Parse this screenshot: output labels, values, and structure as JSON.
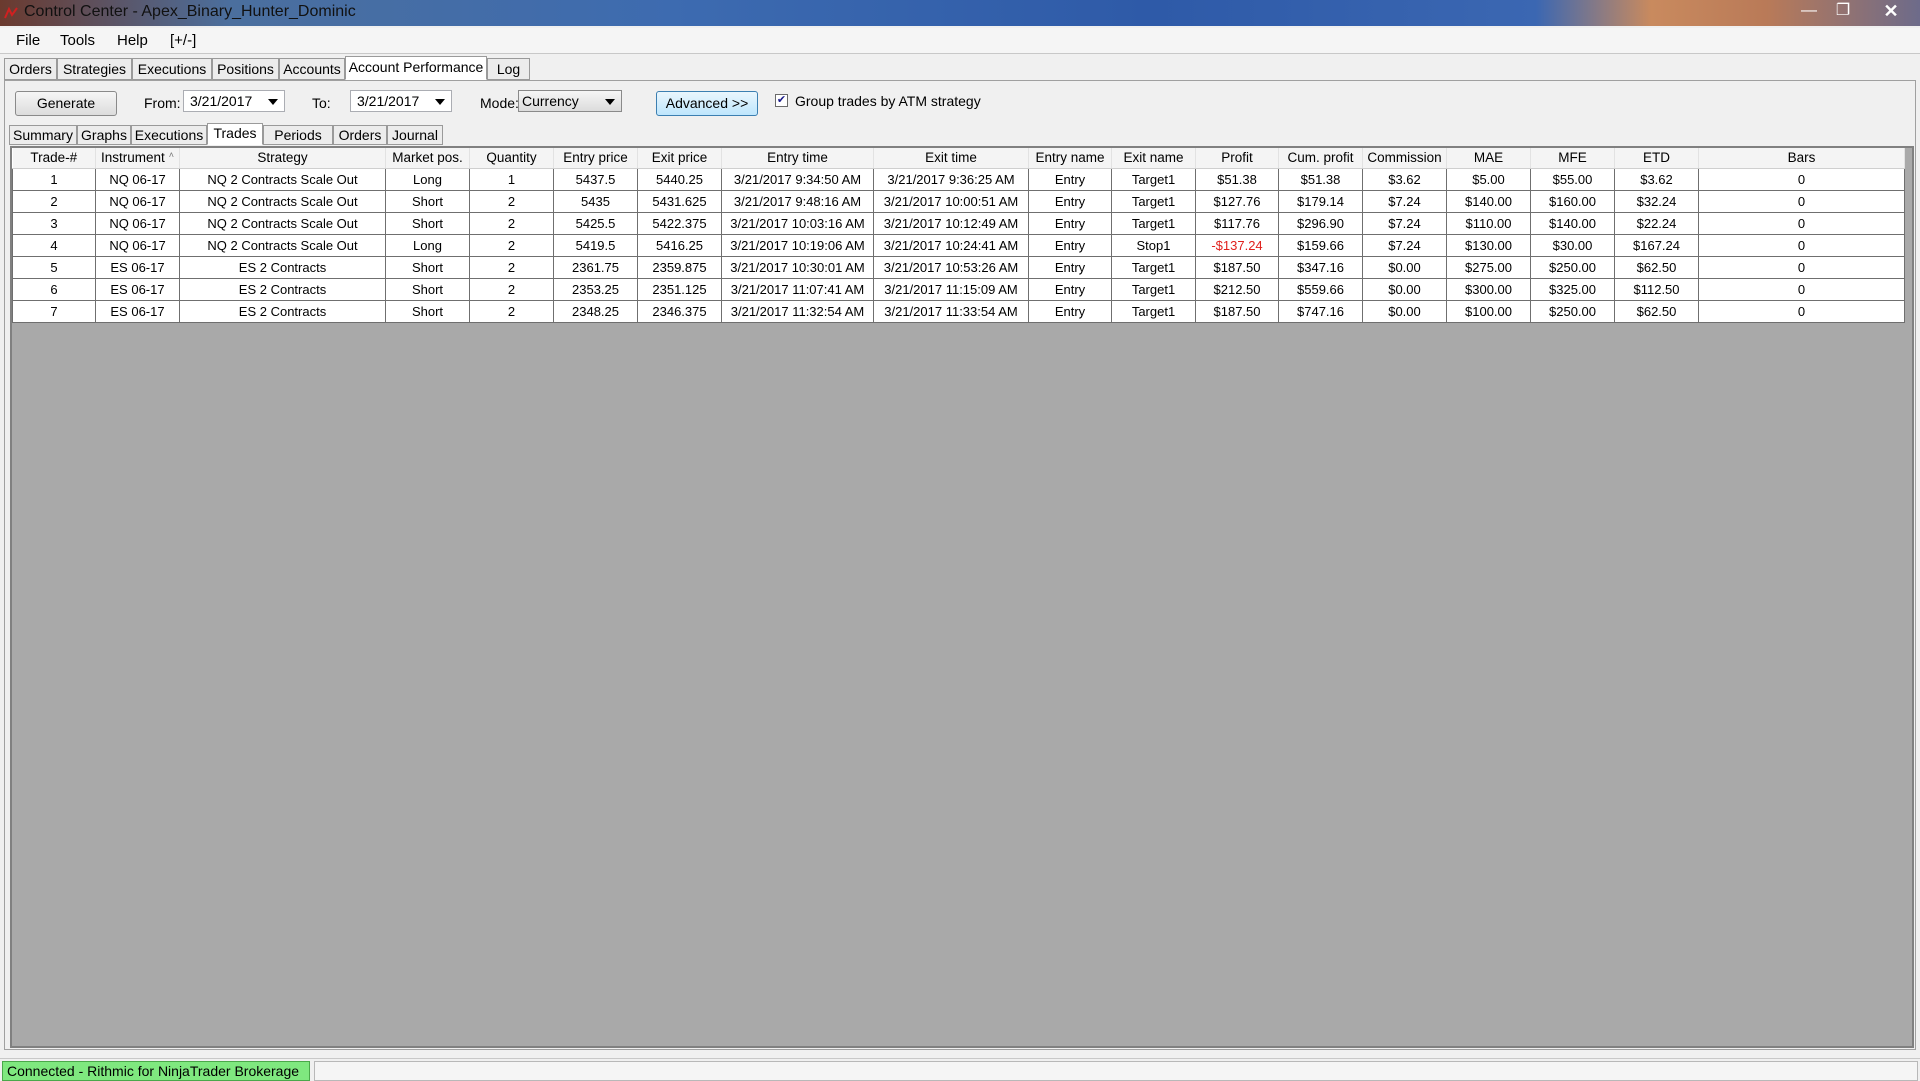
{
  "window": {
    "title": "Control Center - Apex_Binary_Hunter_Dominic",
    "minimize_glyph": "—",
    "maximize_glyph": "❐",
    "close_glyph": "✕"
  },
  "menu": {
    "file": "File",
    "tools": "Tools",
    "help": "Help",
    "toggle": "[+/-]"
  },
  "top_tabs": [
    "Orders",
    "Strategies",
    "Executions",
    "Positions",
    "Accounts",
    "Account Performance",
    "Log"
  ],
  "toolbar": {
    "generate_label": "Generate",
    "from_label": "From:",
    "from_value": "3/21/2017",
    "to_label": "To:",
    "to_value": "3/21/2017",
    "mode_label": "Mode:",
    "mode_value": "Currency",
    "advanced_label": "Advanced >>",
    "group_checkbox_checked": true,
    "group_checkbox_glyph": "✔",
    "group_checkbox_label": "Group trades by ATM strategy"
  },
  "sub_tabs": [
    "Summary",
    "Graphs",
    "Executions",
    "Trades",
    "Periods",
    "Orders",
    "Journal"
  ],
  "grid": {
    "sort_glyph": "˄",
    "columns": [
      "Trade-#",
      "Instrument",
      "Strategy",
      "Market pos.",
      "Quantity",
      "Entry price",
      "Exit price",
      "Entry time",
      "Exit time",
      "Entry name",
      "Exit name",
      "Profit",
      "Cum. profit",
      "Commission",
      "MAE",
      "MFE",
      "ETD",
      "Bars"
    ],
    "rows": [
      [
        "1",
        "NQ 06-17",
        "NQ 2 Contracts Scale Out",
        "Long",
        "1",
        "5437.5",
        "5440.25",
        "3/21/2017 9:34:50 AM",
        "3/21/2017 9:36:25 AM",
        "Entry",
        "Target1",
        "$51.38",
        "$51.38",
        "$3.62",
        "$5.00",
        "$55.00",
        "$3.62",
        "0"
      ],
      [
        "2",
        "NQ 06-17",
        "NQ 2 Contracts Scale Out",
        "Short",
        "2",
        "5435",
        "5431.625",
        "3/21/2017 9:48:16 AM",
        "3/21/2017 10:00:51 AM",
        "Entry",
        "Target1",
        "$127.76",
        "$179.14",
        "$7.24",
        "$140.00",
        "$160.00",
        "$32.24",
        "0"
      ],
      [
        "3",
        "NQ 06-17",
        "NQ 2 Contracts Scale Out",
        "Short",
        "2",
        "5425.5",
        "5422.375",
        "3/21/2017 10:03:16 AM",
        "3/21/2017 10:12:49 AM",
        "Entry",
        "Target1",
        "$117.76",
        "$296.90",
        "$7.24",
        "$110.00",
        "$140.00",
        "$22.24",
        "0"
      ],
      [
        "4",
        "NQ 06-17",
        "NQ 2 Contracts Scale Out",
        "Long",
        "2",
        "5419.5",
        "5416.25",
        "3/21/2017 10:19:06 AM",
        "3/21/2017 10:24:41 AM",
        "Entry",
        "Stop1",
        "-$137.24",
        "$159.66",
        "$7.24",
        "$130.00",
        "$30.00",
        "$167.24",
        "0"
      ],
      [
        "5",
        "ES 06-17",
        "ES 2 Contracts",
        "Short",
        "2",
        "2361.75",
        "2359.875",
        "3/21/2017 10:30:01 AM",
        "3/21/2017 10:53:26 AM",
        "Entry",
        "Target1",
        "$187.50",
        "$347.16",
        "$0.00",
        "$275.00",
        "$250.00",
        "$62.50",
        "0"
      ],
      [
        "6",
        "ES 06-17",
        "ES 2 Contracts",
        "Short",
        "2",
        "2353.25",
        "2351.125",
        "3/21/2017 11:07:41 AM",
        "3/21/2017 11:15:09 AM",
        "Entry",
        "Target1",
        "$212.50",
        "$559.66",
        "$0.00",
        "$300.00",
        "$325.00",
        "$112.50",
        "0"
      ],
      [
        "7",
        "ES 06-17",
        "ES 2 Contracts",
        "Short",
        "2",
        "2348.25",
        "2346.375",
        "3/21/2017 11:32:54 AM",
        "3/21/2017 11:33:54 AM",
        "Entry",
        "Target1",
        "$187.50",
        "$747.16",
        "$0.00",
        "$100.00",
        "$250.00",
        "$62.50",
        "0"
      ]
    ]
  },
  "colors": {
    "negative_profit": "#e0201c",
    "status_connected": "#7fe87f"
  },
  "status": {
    "connection": "Connected - Rithmic for NinjaTrader Brokerage"
  }
}
